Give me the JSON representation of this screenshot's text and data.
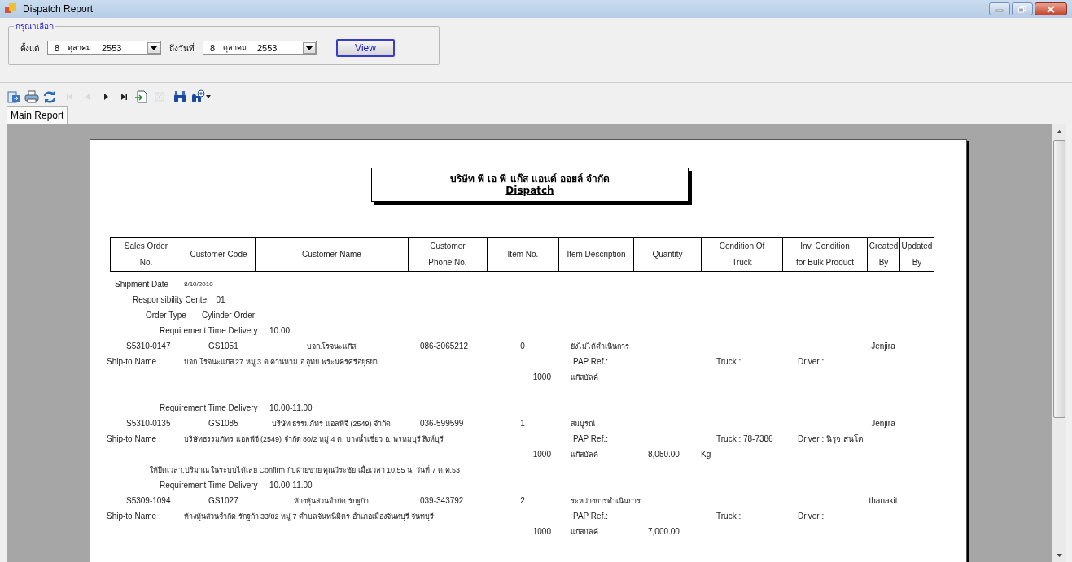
{
  "window": {
    "title": "Dispatch Report"
  },
  "filter": {
    "legend": "กรุณาเลือก",
    "from_label": "ตั้งแต่",
    "from": {
      "day": "8",
      "month": "ตุลาคม",
      "year": "2553"
    },
    "to_label": "ถึงวันที่",
    "to": {
      "day": "8",
      "month": "ตุลาคม",
      "year": "2553"
    },
    "view_button": "View"
  },
  "toolbar": [
    {
      "kind": "export",
      "disabled": false
    },
    {
      "kind": "print",
      "disabled": false
    },
    {
      "kind": "refresh",
      "disabled": false
    },
    {
      "kind": "first",
      "disabled": true
    },
    {
      "kind": "prev",
      "disabled": true
    },
    {
      "kind": "next",
      "disabled": false
    },
    {
      "kind": "last",
      "disabled": false
    },
    {
      "kind": "goto",
      "disabled": false
    },
    {
      "kind": "close",
      "disabled": true
    },
    {
      "kind": "find",
      "disabled": false
    },
    {
      "kind": "zoom",
      "disabled": false
    }
  ],
  "tabs": [
    {
      "label": "Main Report",
      "selected": true
    }
  ],
  "report": {
    "company": "บริษัท พี เอ พี แก๊ส แอนด์ ออยล์ จำกัด",
    "title": "Dispatch",
    "columns": [
      [
        "Sales Order",
        "No."
      ],
      [
        "Customer Code"
      ],
      [
        "Customer Name"
      ],
      [
        "Customer",
        "Phone No."
      ],
      [
        "Item No."
      ],
      [
        "Item Description"
      ],
      [
        "Quantity"
      ],
      [
        "Condition Of",
        "Truck"
      ],
      [
        "Inv. Condition",
        "for Bulk Product"
      ],
      [
        "Created",
        "By"
      ],
      [
        "Updated",
        "By"
      ]
    ],
    "shipment_date": {
      "label": "Shipment Date",
      "value": "8/10/2010"
    },
    "responsibility_center": {
      "label": "Responsibility Center",
      "value": "01"
    },
    "order_type": {
      "label": "Order Type",
      "value": "Cylinder Order"
    },
    "orders": [
      {
        "delivery_label": "Requirement Time Delivery",
        "delivery_time": "10.00",
        "sales_order_no": "S5310-0147",
        "customer_code": "GS1051",
        "customer_name": "บจก.โรจนะแก๊ส",
        "phone": "086-3065212",
        "item_no": "0",
        "status": "ยังไม่ได้ดำเนินการ",
        "created_by": "Jenjira",
        "ship_to_label": "Ship-to Name :",
        "ship_to": "บจก.โรจนะแก๊ส 27 หมู่ 3 ต.คานหาม อ.อุทัย พระนครศรีอยุธยา",
        "pap_ref": "PAP Ref.:",
        "truck": "Truck :",
        "driver": "Driver :",
        "item_code": "1000",
        "product": "แก๊สบัลค์"
      },
      {
        "delivery_label": "Requirement Time Delivery",
        "delivery_time": "10.00-11.00",
        "sales_order_no": "S5310-0135",
        "customer_code": "GS1085",
        "customer_name": "บริษัท ธรรมภัทร แอลพีจี (2549) จำกัด",
        "phone": "036-599599",
        "item_no": "1",
        "status": "สมบูรณ์",
        "created_by": "Jenjira",
        "ship_to_label": "Ship-to Name :",
        "ship_to": "บริษัทธรรมภัทร แอลพีจี (2549) จำกัด 80/2 หมู่ 4 ต. บางน้ำเชี่ยว อ. พรหมบุรี สิงห์บุรี",
        "pap_ref": "PAP Ref.:",
        "truck": "Truck : 78-7386",
        "driver": "Driver : นิรุจ สนโต",
        "item_code": "1000",
        "product": "แก๊สบัลค์",
        "quantity": "8,050.00",
        "unit": "Kg",
        "note": "ให้ยึดเวลา,ปริมาณ ในระบบได้เลย Confirm กับฝ่ายขาย คุณวีระชัย เมื่อเวลา 10.55 น. วันที่ 7 ต.ค.53"
      },
      {
        "delivery_label": "Requirement Time Delivery",
        "delivery_time": "10.00-11.00",
        "sales_order_no": "S5309-1094",
        "customer_code": "GS1027",
        "customer_name": "ห้างหุ้นส่วนจำกัด รักฐก้า",
        "phone": "039-343792",
        "item_no": "2",
        "status": "ระหว่างการดำเนินการ",
        "created_by": "thanakit",
        "ship_to_label": "Ship-to Name :",
        "ship_to": "ห้างหุ้นส่วนจำกัด รักฐก้า 33/82 หมู่ 7 ตำบลจันทนิมิตร อำเภอเมืองจันทบุรี จันทบุรี",
        "pap_ref": "PAP Ref.:",
        "truck": "Truck :",
        "driver": "Driver :",
        "item_code": "1000",
        "product": "แก๊สบัลค์",
        "quantity": "7,000.00"
      }
    ]
  }
}
